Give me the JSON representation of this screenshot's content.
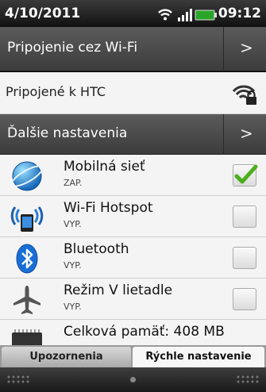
{
  "status_bar": {
    "date": "4/10/2011",
    "time": "09:12"
  },
  "rows": {
    "wifi_connect": {
      "label": "Pripojenie cez Wi-Fi",
      "chevron": ">"
    },
    "connected": {
      "label": "Pripojené k HTC"
    },
    "more_settings": {
      "label": "Ďalšie nastavenia",
      "chevron": ">"
    }
  },
  "items": [
    {
      "title": "Mobilná sieť",
      "subtitle": "ZAP.",
      "checked": true,
      "icon": "globe-icon"
    },
    {
      "title": "Wi-Fi Hotspot",
      "subtitle": "VYP.",
      "checked": false,
      "icon": "wifi-hotspot-icon"
    },
    {
      "title": "Bluetooth",
      "subtitle": "VYP.",
      "checked": false,
      "icon": "bluetooth-icon"
    },
    {
      "title": "Režim V lietadle",
      "subtitle": "VYP.",
      "checked": false,
      "icon": "airplane-icon"
    },
    {
      "title": "Celková pamäť: 408 MB",
      "icon": "memory-chip-icon"
    }
  ],
  "tabs": {
    "notifications": "Upozornenia",
    "quick_settings": "Rýchle nastavenie"
  },
  "colors": {
    "check_green": "#4caf1e",
    "bluetooth_blue": "#1a6fd6"
  }
}
